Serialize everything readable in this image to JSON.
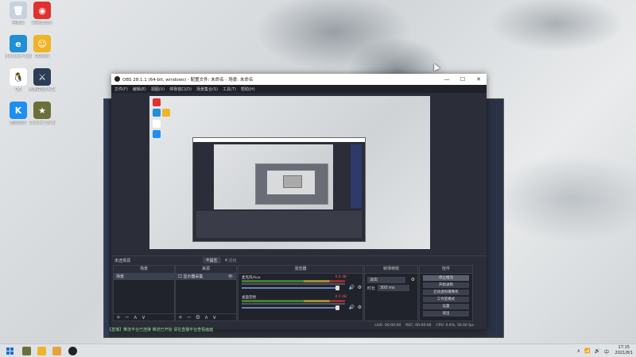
{
  "desktop": {
    "icons": [
      {
        "label": "回收站",
        "glyph": "🗑",
        "color": "#c7d2de"
      },
      {
        "label": "网易云音乐",
        "glyph": "◉",
        "color": "#e0312f"
      },
      {
        "label": "Microsoft Edge",
        "glyph": "e",
        "color": "#1f8fd6"
      },
      {
        "label": "QQ游戏",
        "glyph": "☺",
        "color": "#f0b428"
      },
      {
        "label": "QQ",
        "glyph": "🐧",
        "color": "#ffffff"
      },
      {
        "label": "英雄联盟WeGame版",
        "glyph": "⚔",
        "color": "#2d3d55"
      },
      {
        "label": "酷狗音乐",
        "glyph": "K",
        "color": "#1d8ff0"
      },
      {
        "label": "Counter-Strike",
        "glyph": "★",
        "color": "#6b6f3a"
      }
    ]
  },
  "obs": {
    "title": "OBS 28.1.1 (64-bit, windows) - 配置文件: 未命名 - 场景: 未命名",
    "window_buttons": [
      "—",
      "☐",
      "✕"
    ],
    "menu": [
      "文件(F)",
      "编辑(E)",
      "视图(V)",
      "停靠窗口(D)",
      "场景集合(S)",
      "工具(T)",
      "帮助(H)"
    ],
    "source_bar": {
      "label": "未选择源",
      "tab_properties": "属性",
      "tab_filters": "滤镜"
    },
    "scenes": {
      "header": "场景",
      "items": [
        "场景"
      ],
      "footer_icons": [
        "+",
        "−",
        "∧",
        "∨"
      ]
    },
    "sources": {
      "header": "来源",
      "items": [
        "显示器采集"
      ],
      "footer_icons": [
        "+",
        "−",
        "⚙",
        "∧",
        "∨"
      ]
    },
    "mixer": {
      "header": "混音器",
      "channels": [
        {
          "name": "麦克风/Aux",
          "db": "0.0 dB"
        },
        {
          "name": "桌面音频",
          "db": "0.0 dB"
        }
      ]
    },
    "transitions": {
      "header": "转场特效",
      "type": "淡出",
      "duration_label": "时长",
      "duration": "300 ms"
    },
    "controls": {
      "header": "控件",
      "buttons": [
        "停止推流",
        "开始录制",
        "启动虚拟摄像机",
        "工作室模式",
        "设置",
        "退出"
      ]
    },
    "status": {
      "live": "LIVE: 00:00:00",
      "rec": "REC: 00:00:00",
      "cpu": "CPU: 0.6%, 30.00 fps"
    },
    "ticker": "【直播】推流平台已连接 推流已开始 请在直播平台查看画面"
  },
  "taskbar": {
    "tray": [
      "∧",
      "📶",
      "🔊",
      "中"
    ],
    "time": "17:15",
    "date": "2021/8/1"
  }
}
